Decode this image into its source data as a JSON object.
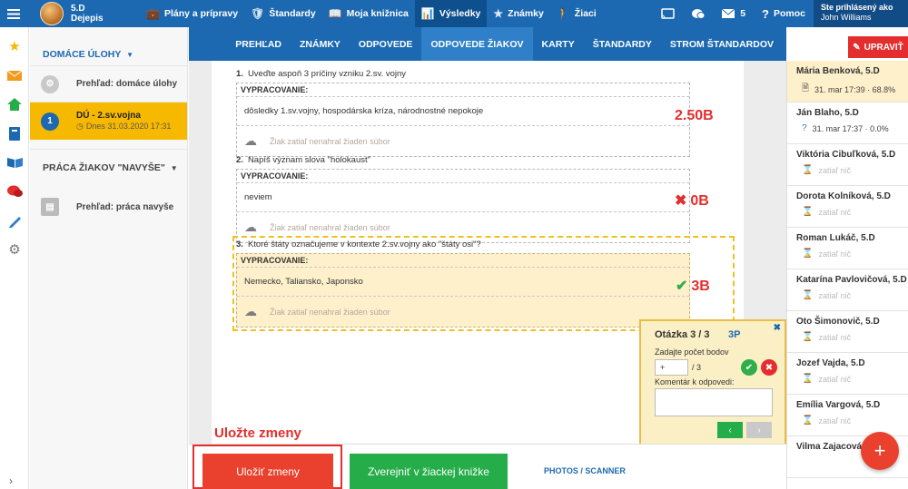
{
  "topbar": {
    "class_name": "5.D",
    "subject": "Dejepis",
    "nav": [
      {
        "icon": "briefcase-icon",
        "glyph": "💼",
        "label": "Plány a prípravy"
      },
      {
        "icon": "shield-icon",
        "glyph": "🛡",
        "label": "Štandardy"
      },
      {
        "icon": "book-icon",
        "glyph": "📖",
        "label": "Moja knižnica"
      },
      {
        "icon": "bar-chart-icon",
        "glyph": "📊",
        "label": "Výsledky"
      },
      {
        "icon": "star-icon",
        "glyph": "★",
        "label": "Známky"
      },
      {
        "icon": "students-icon",
        "glyph": "🚶",
        "label": "Žiaci"
      }
    ],
    "message_count": "5",
    "help_label": "Pomoc",
    "login_label": "Ste prihlásený ako",
    "user_name": "John Williams"
  },
  "sidebar": {
    "section1": "DOMÁCE ÚLOHY",
    "items": [
      {
        "badge": "",
        "label": "Prehľad: domáce úlohy"
      },
      {
        "badge": "1",
        "label": "DÚ - 2.sv.vojna",
        "sub": "Dnes 31.03.2020 17:31"
      }
    ],
    "section2": "PRÁCA ŽIAKOV \"NAVYŠE\"",
    "extra_item": "Prehľad: práca navyše"
  },
  "tabs": [
    "PREHĽAD",
    "ZNÁMKY",
    "ODPOVEDE",
    "ODPOVEDE ŽIAKOV",
    "KARTY",
    "ŠTANDARDY",
    "STROM ŠTANDARDOV"
  ],
  "edit_button": "UPRAVIŤ",
  "questions": [
    {
      "num": "1.",
      "text": "Uveďte aspoň 3 príčiny vzniku 2.sv. vojny",
      "answer_label": "VYPRACOVANIE:",
      "answer": "dôsledky 1.sv.vojny, hospodárska kríza, národnostné nepokoje",
      "upload": "Žiak zatiaľ nenahral žiaden súbor",
      "score": "2.50B",
      "mark": ""
    },
    {
      "num": "2.",
      "text": "Napíš význam slova \"holokaust\"",
      "answer_label": "VYPRACOVANIE:",
      "answer": "neviem",
      "upload": "Žiak zatiaľ nenahral žiaden súbor",
      "score": "0B",
      "mark": "✖"
    },
    {
      "num": "3.",
      "text": "Ktoré štáty označujeme v kontexte 2.sv.vojny ako \"štáty osi\"?",
      "answer_label": "VYPRACOVANIE:",
      "answer": "Nemecko, Taliansko, Japonsko",
      "upload": "Žiak zatiaľ nenahral žiaden súbor",
      "score": "3B",
      "mark": "✔"
    }
  ],
  "popup": {
    "title": "Otázka 3 / 3",
    "points": "3P",
    "points_label": "Zadajte počet bodov",
    "points_value": "+",
    "points_max": "/ 3",
    "comment_label": "Komentár k odpovedi:"
  },
  "students": [
    {
      "name": "Mária Benková, 5.D",
      "icon": "document-icon",
      "meta": "31. mar 17:39 · 68.8%",
      "state": "active"
    },
    {
      "name": "Ján Blaho, 5.D",
      "icon": "question-icon",
      "meta": "31. mar 17:37 · 0.0%",
      "state": "done"
    },
    {
      "name": "Viktória Cibuľková, 5.D",
      "icon": "hourglass-icon",
      "meta": "zatiaľ nič",
      "state": "none"
    },
    {
      "name": "Dorota Kolníková, 5.D",
      "icon": "hourglass-icon",
      "meta": "zatiaľ nič",
      "state": "none"
    },
    {
      "name": "Roman Lukáč, 5.D",
      "icon": "hourglass-icon",
      "meta": "zatiaľ nič",
      "state": "none"
    },
    {
      "name": "Katarína Pavlovičová, 5.D",
      "icon": "hourglass-icon",
      "meta": "zatiaľ nič",
      "state": "none"
    },
    {
      "name": "Oto Šimonovič, 5.D",
      "icon": "hourglass-icon",
      "meta": "zatiaľ nič",
      "state": "none"
    },
    {
      "name": "Jozef Vajda, 5.D",
      "icon": "hourglass-icon",
      "meta": "zatiaľ nič",
      "state": "none"
    },
    {
      "name": "Emília Vargová, 5.D",
      "icon": "hourglass-icon",
      "meta": "zatiaľ nič",
      "state": "none"
    },
    {
      "name": "Vilma Zajacová, 5.D",
      "icon": "hourglass-icon",
      "meta": "",
      "state": "none"
    }
  ],
  "bottom": {
    "hint": "Uložte zmeny",
    "save": "Uložiť zmeny",
    "publish": "Zverejniť v žiackej knižke",
    "photos": "PHOTOS / SCANNER"
  },
  "colors": {
    "primary": "#1c69b1",
    "accent": "#f7b900",
    "danger": "#e42e2e",
    "success": "#25ad4a"
  }
}
